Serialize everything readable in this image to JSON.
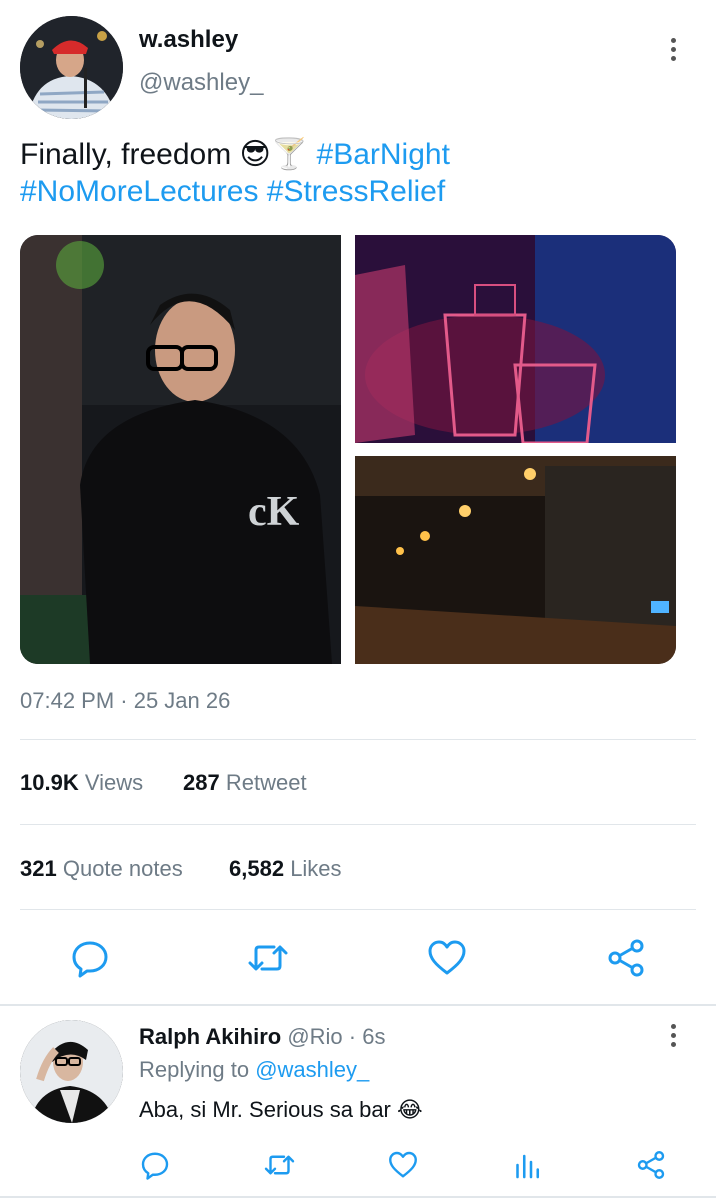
{
  "tweet": {
    "display_name": "w.ashley",
    "handle": "@washley_",
    "text_main": "Finally, freedom",
    "text_emojis": "😎🍸",
    "hashtags_line1": "#BarNight",
    "hashtags_line2": "#NoMoreLectures #StressRelief",
    "shirt_logo": "cK",
    "timestamp": "07:42 PM · 25 Jan 26",
    "stats": {
      "views_count": "10.9K",
      "views_label": "Views",
      "retweet_count": "287",
      "retweet_label": "Retweet",
      "quote_count": "321",
      "quote_label": "Quote notes",
      "likes_count": "6,582",
      "likes_label": "Likes"
    },
    "icons": [
      "reply-icon",
      "retweet-icon",
      "like-icon",
      "share-icon"
    ]
  },
  "reply": {
    "display_name": "Ralph Akihiro",
    "handle": "@Rio",
    "time": "· 6s",
    "replying_prefix": "Replying to",
    "replying_handle": "@washley_",
    "text": "Aba, si Mr. Serious sa bar",
    "emoji": "😂",
    "icons": [
      "reply-icon",
      "retweet-icon",
      "like-icon",
      "analytics-icon",
      "share-icon"
    ]
  },
  "colors": {
    "accent": "#1d9bf0",
    "secondary_text": "#6e7b86",
    "divider": "#e1e6ea"
  }
}
